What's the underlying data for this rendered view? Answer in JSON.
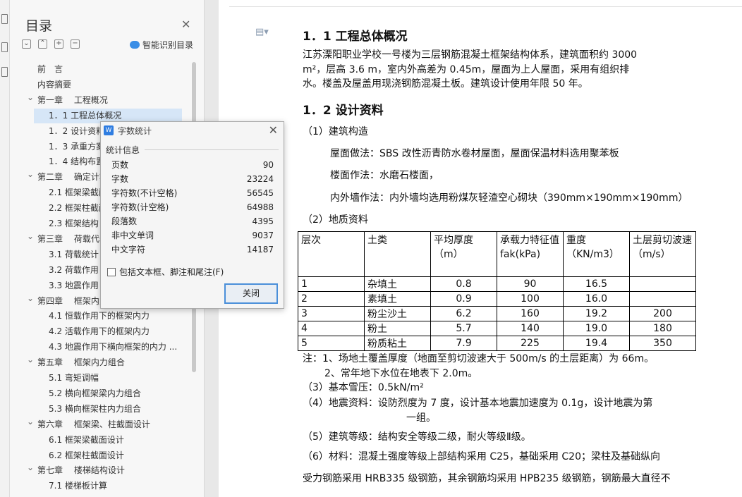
{
  "toc": {
    "title": "目录",
    "smart_label": "智能识别目录",
    "items": [
      {
        "label": "前　言",
        "level": 0
      },
      {
        "label": "内容摘要",
        "level": 0
      },
      {
        "label": "第一章　 工程概况",
        "level": 0
      },
      {
        "label": "1．1 工程总体概况",
        "level": 1
      },
      {
        "label": "1．2 设计资料",
        "level": 1
      },
      {
        "label": "1．3 承重方案",
        "level": 1
      },
      {
        "label": "1．4 结构布置",
        "level": 1
      },
      {
        "label": "第二章　 确定计算简图",
        "level": 0
      },
      {
        "label": "2.1 框架梁截面",
        "level": 1
      },
      {
        "label": "2.2 框架柱截面",
        "level": 1
      },
      {
        "label": "2.3 框架结构",
        "level": 1
      },
      {
        "label": "第三章　 荷载代表值",
        "level": 0
      },
      {
        "label": "3.1 荷载统计",
        "level": 1
      },
      {
        "label": "3.2 荷载作用",
        "level": 1
      },
      {
        "label": "3.3 地震作用",
        "level": 1
      },
      {
        "label": "第四章　 框架内力计算",
        "level": 0
      },
      {
        "label": "4.1 恒载作用下的框架内力",
        "level": 1
      },
      {
        "label": "4.2 活载作用下的框架内力",
        "level": 1
      },
      {
        "label": "4.3 地震作用下横向框架的内力 ...",
        "level": 1
      },
      {
        "label": "第五章　 框架内力组合",
        "level": 0
      },
      {
        "label": "5.1 弯矩调幅",
        "level": 1
      },
      {
        "label": "5.2 横向框架梁内力组合",
        "level": 1
      },
      {
        "label": "5.3 横向框架柱内力组合",
        "level": 1
      },
      {
        "label": "第六章　 框架梁、柱截面设计",
        "level": 0
      },
      {
        "label": "6.1 框架梁截面设计",
        "level": 1
      },
      {
        "label": "6.2 框架柱截面设计",
        "level": 1
      },
      {
        "label": "第七章　 楼梯结构设计",
        "level": 0
      },
      {
        "label": "7.1 楼梯板计算",
        "level": 1
      }
    ]
  },
  "dialog": {
    "title": "字数统计",
    "section": "统计信息",
    "rows": [
      {
        "label": "页数",
        "value": "90"
      },
      {
        "label": "字数",
        "value": "23224"
      },
      {
        "label": "字符数(不计空格)",
        "value": "56545"
      },
      {
        "label": "字符数(计空格)",
        "value": "64988"
      },
      {
        "label": "段落数",
        "value": "4395"
      },
      {
        "label": "非中文单词",
        "value": "9037"
      },
      {
        "label": "中文字符",
        "value": "14187"
      }
    ],
    "checkbox_label": "包括文本框、脚注和尾注(F)",
    "close_label": "关闭"
  },
  "doc": {
    "h1": "1．1 工程总体概况",
    "p1": "江苏溧阳职业学校一号楼为三层钢筋混凝土框架结构体系，建筑面积约 3000",
    "p2": "m²，层高 3.6 m，室内外高差为 0.45m，屋面为上人屋面，采用有组织排",
    "p3": "水。楼盖及屋盖用现浇钢筋混凝土板。建筑设计使用年限 50 年。",
    "h2": "1．2 设计资料",
    "s1": "（1）建筑构造",
    "s1a": "屋面做法：SBS 改性沥青防水卷材屋面，屋面保温材料选用聚苯板",
    "s1b": "楼面作法：水磨石楼面，",
    "s1c": "内外墙作法：内外墙均选用粉煤灰轻渣空心砌块（390mm×190mm×190mm）",
    "s2": "（2）地质资料",
    "table": {
      "headers": [
        "层次",
        "土类",
        "平均厚度（m）",
        "承载力特征值 fak(kPa)",
        "重度（KN/m3）",
        "土层剪切波速（m/s）"
      ],
      "rows": [
        [
          "1",
          "杂填土",
          "0.8",
          "90",
          "16.5",
          ""
        ],
        [
          "2",
          "素填土",
          "0.9",
          "100",
          "16.0",
          ""
        ],
        [
          "3",
          "粉尘沙土",
          "6.2",
          "160",
          "19.2",
          "200"
        ],
        [
          "4",
          "粉土",
          "5.7",
          "140",
          "19.0",
          "180"
        ],
        [
          "5",
          "粉质粘土",
          "7.9",
          "225",
          "19.4",
          "350"
        ]
      ]
    },
    "note1": "注：1、场地土覆盖厚度（地面至剪切波速大于 500m/s 的土层距离）为 66m。",
    "note2": "2、常年地下水位在地表下 2.0m。",
    "s3": "（3）基本雪压：0.5kN/m²",
    "s4a": "（4）地震资料：设防烈度为 7 度，设计基本地震加速度为 0.1g，设计地震为第",
    "s4b": "一组。",
    "s5": "（5）建筑等级：结构安全等级二级，耐火等级Ⅱ级。",
    "s6a": "（6）材料：混凝土强度等级上部结构采用 C25，基础采用 C20；梁柱及基础纵向",
    "s6b": "受力钢筋采用 HRB335 级钢筋，其余钢筋均采用 HPB235 级钢筋，钢筋最大直径不"
  }
}
